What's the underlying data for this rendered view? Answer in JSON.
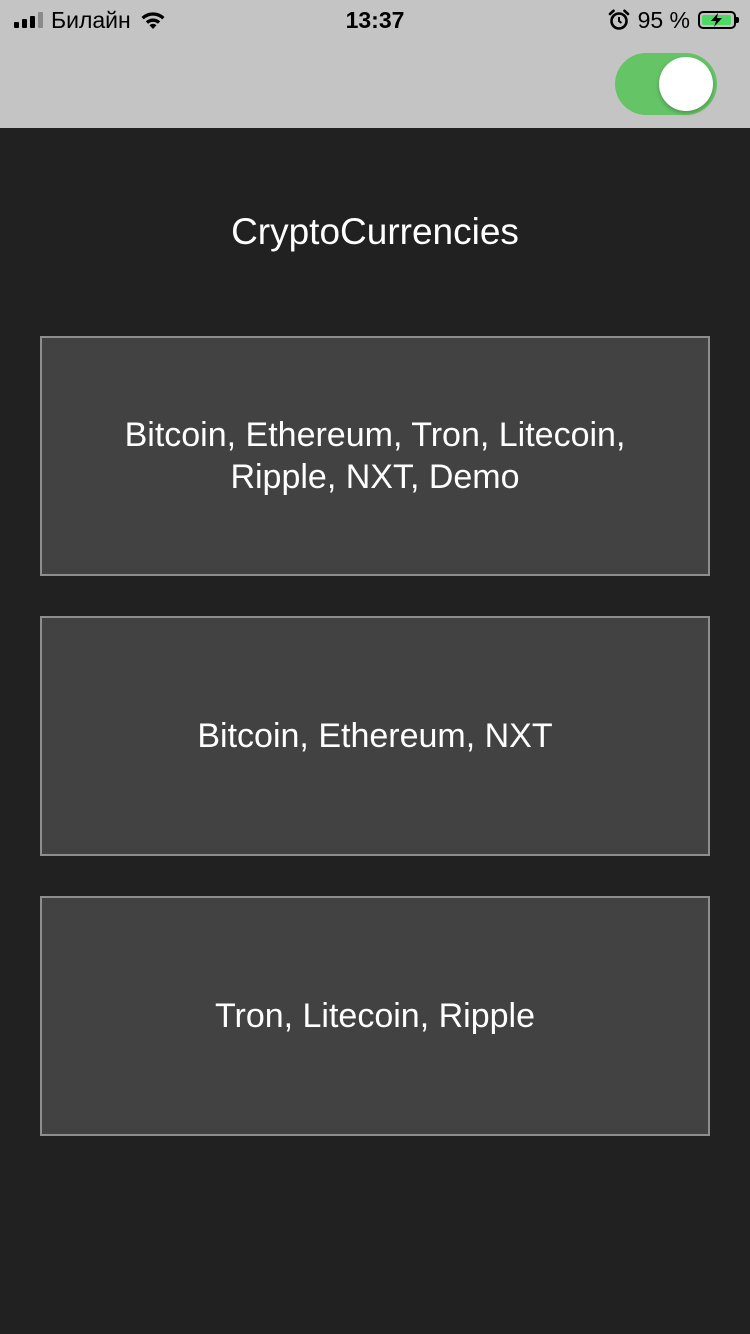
{
  "status_bar": {
    "carrier": "Билайн",
    "time": "13:37",
    "battery_percent": "95 %",
    "battery_level": 0.95,
    "icons": [
      "signal-icon",
      "wifi-icon",
      "alarm-icon",
      "battery-charging-icon"
    ]
  },
  "nav": {
    "theme_toggle_on": true,
    "toggle_color": "#65c466"
  },
  "main": {
    "title": "CryptoCurrencies",
    "cards": [
      {
        "label": "Bitcoin, Ethereum, Tron, Litecoin, Ripple, NXT, Demo"
      },
      {
        "label": "Bitcoin, Ethereum, NXT"
      },
      {
        "label": "Tron, Litecoin, Ripple"
      }
    ]
  },
  "colors": {
    "background": "#212121",
    "card_background": "#424242",
    "card_border": "#8e8e8e",
    "bar_background": "#c4c4c4",
    "text": "#ffffff"
  }
}
